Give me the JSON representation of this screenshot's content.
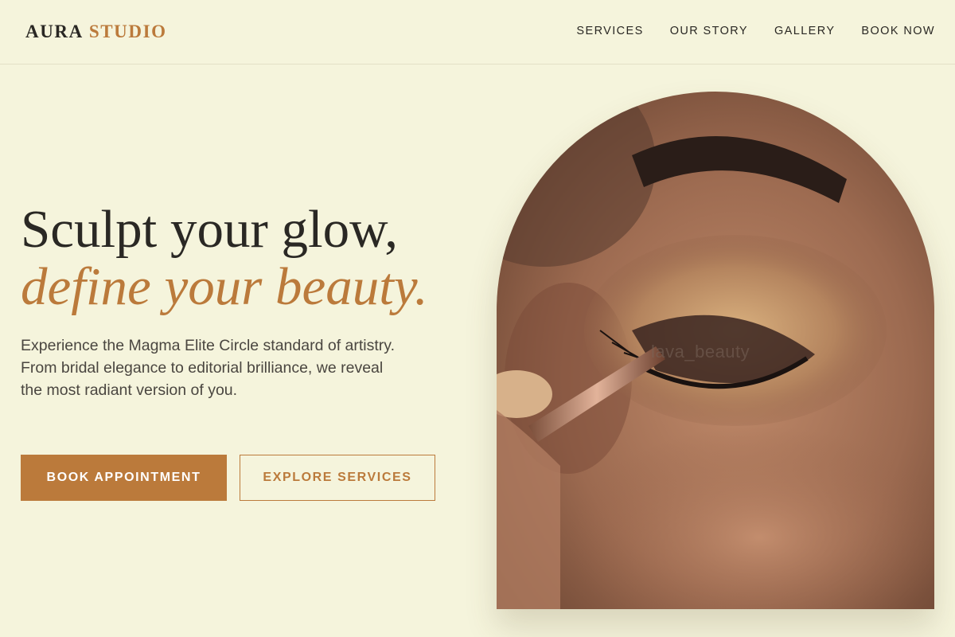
{
  "header": {
    "logo_primary": "AURA",
    "logo_accent": "STUDIO",
    "nav": [
      "SERVICES",
      "OUR STORY",
      "GALLERY",
      "BOOK NOW"
    ]
  },
  "hero": {
    "headline_line1": "Sculpt your glow,",
    "headline_line2": "define your beauty.",
    "description": "Experience the Magma Elite Circle standard of artistry. From bridal elegance to editorial brilliance, we reveal the most radiant version of you.",
    "primary_button": "BOOK APPOINTMENT",
    "secondary_button": "EXPLORE SERVICES",
    "image_watermark": "lava_beauty"
  },
  "colors": {
    "background": "#f5f4dc",
    "accent": "#bb7a3b",
    "text": "#2a2824"
  }
}
